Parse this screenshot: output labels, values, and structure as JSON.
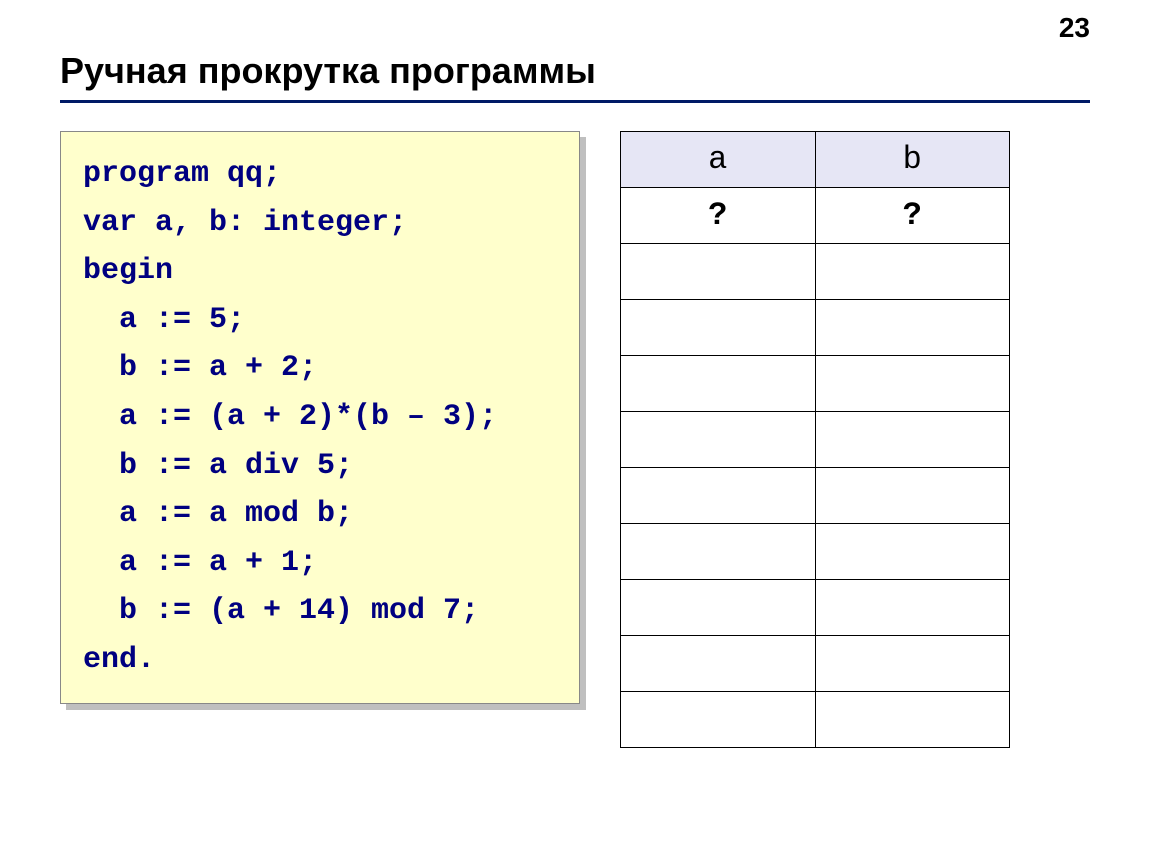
{
  "page_number": "23",
  "title": "Ручная прокрутка программы",
  "code": {
    "lines": [
      "program qq;",
      "var a, b: integer;",
      "begin",
      "  a := 5;",
      "  b := a + 2;",
      "  a := (a + 2)*(b – 3);",
      "  b := a div 5;",
      "  a := a mod b;",
      "  a := a + 1;",
      "  b := (a + 14) mod 7;",
      "end."
    ]
  },
  "trace_table": {
    "headers": [
      "a",
      "b"
    ],
    "rows": [
      [
        "?",
        "?"
      ],
      [
        "",
        ""
      ],
      [
        "",
        ""
      ],
      [
        "",
        ""
      ],
      [
        "",
        ""
      ],
      [
        "",
        ""
      ],
      [
        "",
        ""
      ],
      [
        "",
        ""
      ],
      [
        "",
        ""
      ],
      [
        "",
        ""
      ]
    ]
  }
}
